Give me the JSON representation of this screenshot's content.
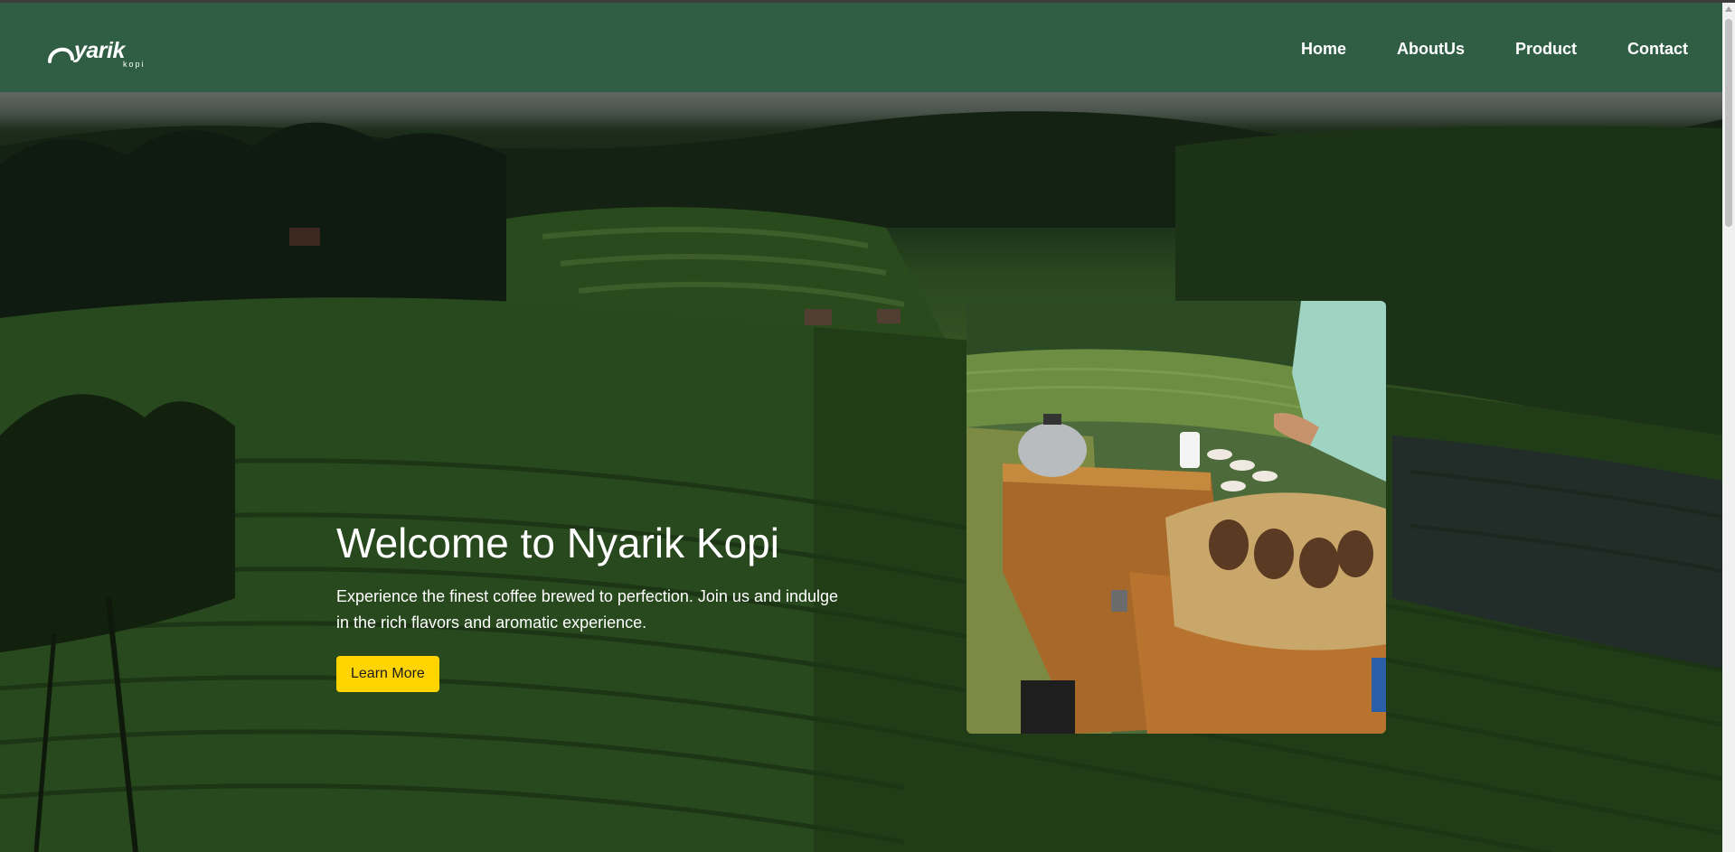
{
  "logo": {
    "wordmark": "yarik",
    "tagline": "kopi"
  },
  "nav": {
    "items": [
      {
        "label": "Home"
      },
      {
        "label": "AboutUs"
      },
      {
        "label": "Product"
      },
      {
        "label": "Contact"
      }
    ]
  },
  "hero": {
    "title": "Welcome to Nyarik Kopi",
    "description": "Experience the finest coffee brewed to perfection. Join us and indulge in the rich flavors and aromatic experience.",
    "cta_label": "Learn More"
  },
  "colors": {
    "navbar": "#2f5e45",
    "cta": "#ffd400",
    "text": "#ffffff"
  }
}
